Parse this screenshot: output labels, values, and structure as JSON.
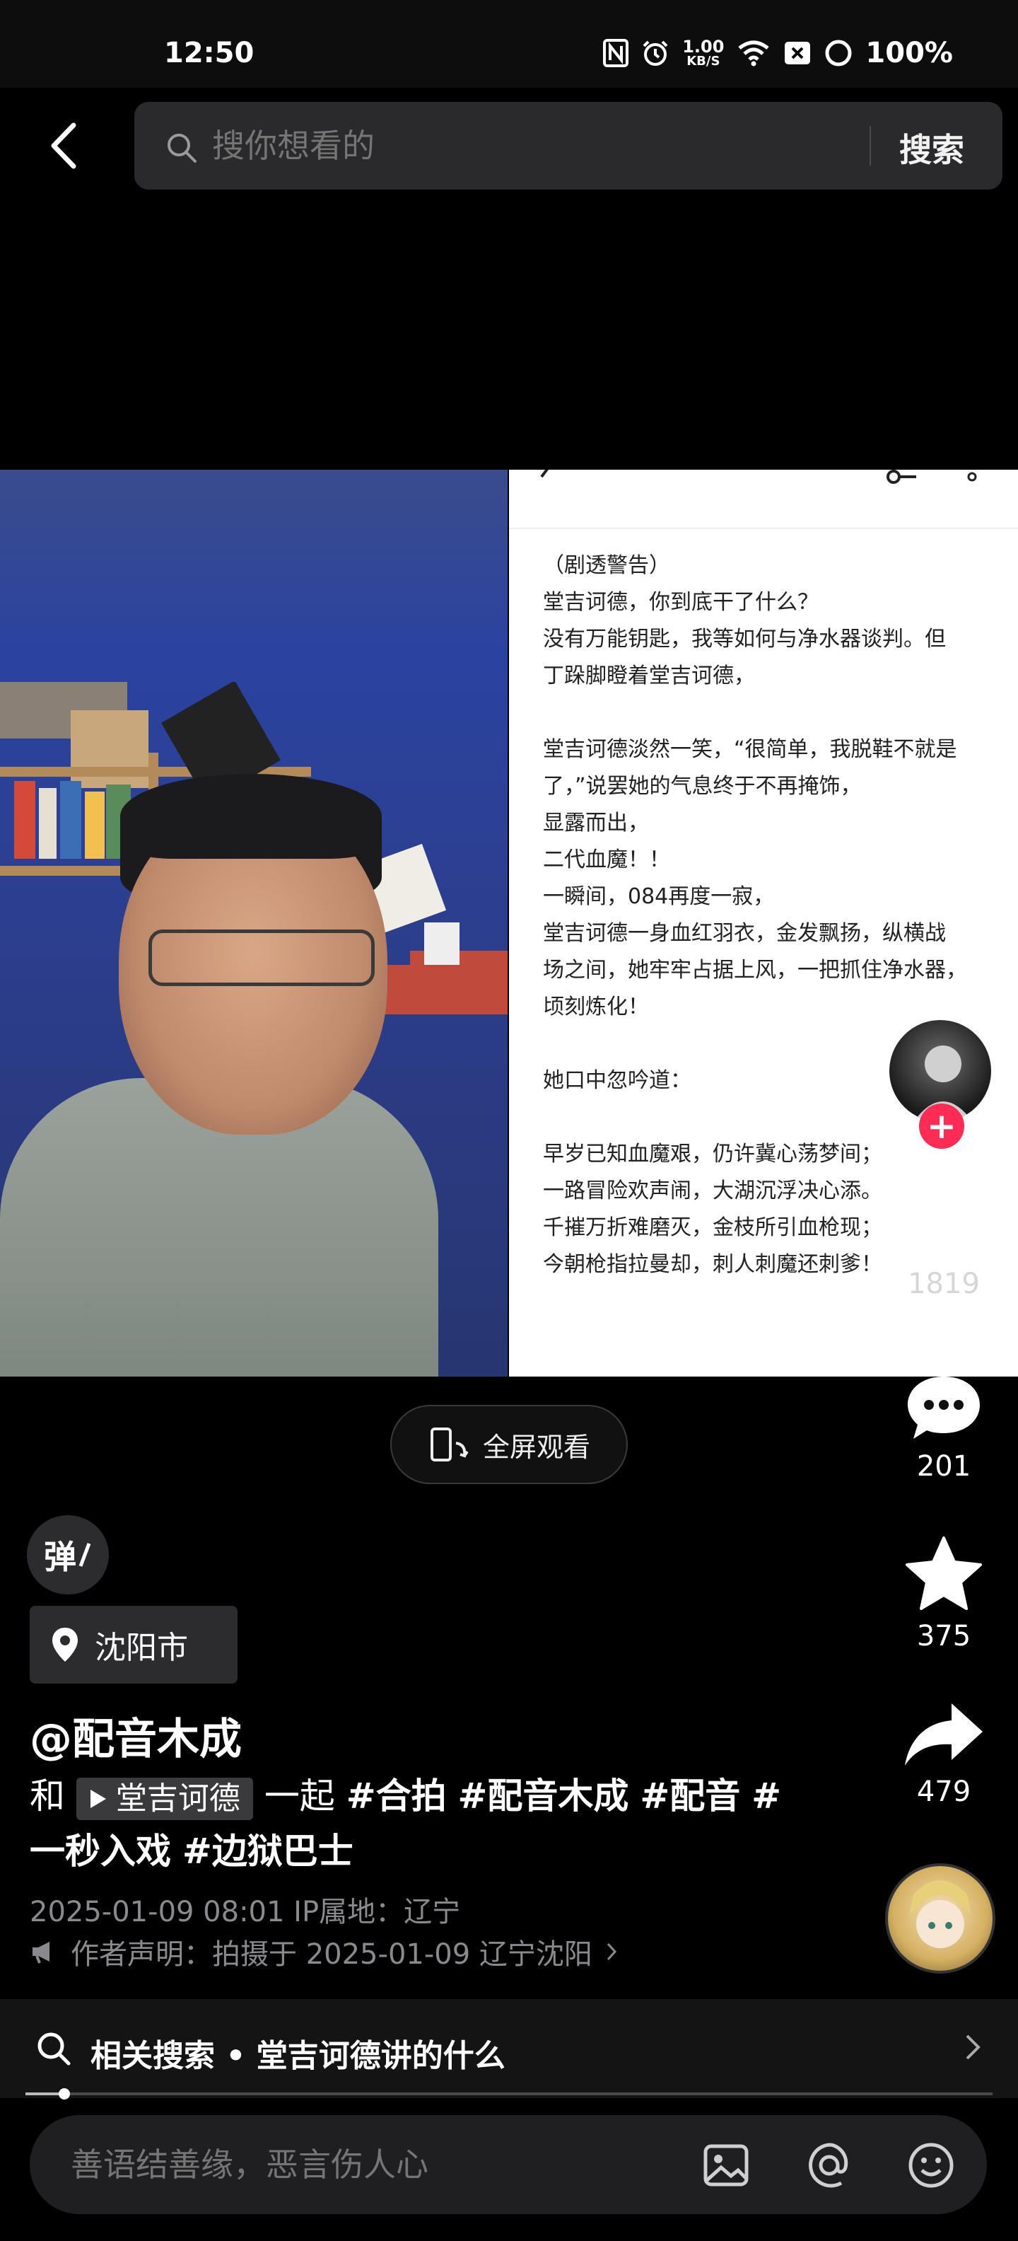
{
  "status_bar": {
    "time": "12:50",
    "network_speed": "1.00",
    "network_unit": "KB/S",
    "battery": "100%"
  },
  "search": {
    "placeholder": "搜你想看的",
    "submit_label": "搜索"
  },
  "video": {
    "right_text": "（剧透警告）\n堂吉诃德，你到底干了什么？\n没有万能钥匙，我等如何与净水器谈判。但\n丁跺脚瞪着堂吉诃德，\n\n堂吉诃德淡然一笑，“很简单，我脱鞋不就是\n了，”说罢她的气息终于不再掩饰，\n显露而出，\n二代血魔！！\n一瞬间，084再度一寂，\n堂吉诃德一身血红羽衣，金发飘扬，纵横战\n场之间，她牢牢占据上风，一把抓住净水器，\n顷刻炼化！\n\n她口中忽吟道：\n\n早岁已知血魔艰，仍许冀心荡梦间；\n一路冒险欢声闹，大湖沉浮决心添。\n千摧万折难磨灭，金枝所引血枪现；\n今朝枪指拉曼却，刺人刺魔还刺爹！"
  },
  "actions": {
    "follow": "+",
    "likes": "1819",
    "comments": "201",
    "favorites": "375",
    "shares": "479"
  },
  "fullscreen_label": "全屏观看",
  "danmaku_label": "弹",
  "location": "沈阳市",
  "author": "@配音木成",
  "description": {
    "prefix": "和",
    "duet_user": "堂吉诃德",
    "middle": "一起",
    "tags": [
      "#合拍",
      "#配音木成",
      "#配音",
      "#一秒入戏",
      "#边狱巴士"
    ]
  },
  "meta": {
    "date_ip": "2025-01-09 08:01  IP属地：辽宁",
    "statement": "作者声明：拍摄于 2025-01-09 辽宁沈阳"
  },
  "related_search": "相关搜索 • 堂吉诃德讲的什么",
  "progress": 0.04,
  "comment": {
    "placeholder": "善语结善缘，恶言伤人心"
  }
}
